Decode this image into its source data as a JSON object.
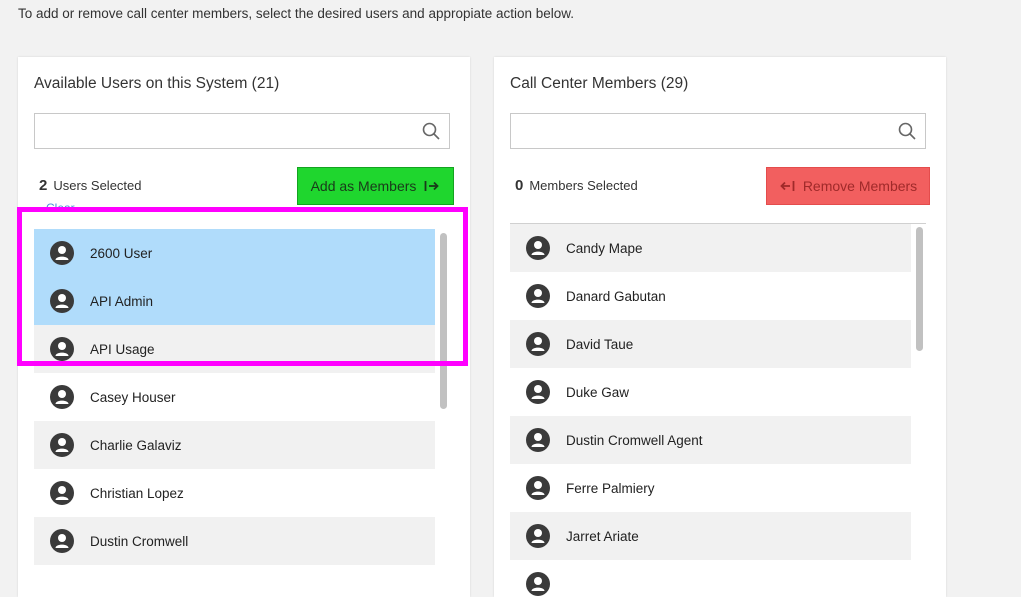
{
  "intro_text": "To add or remove call center members, select the desired users and appropiate action below.",
  "available": {
    "title": "Available Users on this System (21)",
    "search_placeholder": "",
    "selected_count": "2",
    "selected_label": "Users Selected",
    "clear_label": "Clear",
    "add_button_label": "Add as Members",
    "users": [
      {
        "name": "2600 User",
        "selected": true
      },
      {
        "name": "API Admin",
        "selected": true
      },
      {
        "name": "API Usage",
        "selected": false
      },
      {
        "name": "Casey Houser",
        "selected": false
      },
      {
        "name": "Charlie Galaviz",
        "selected": false
      },
      {
        "name": "Christian Lopez",
        "selected": false
      },
      {
        "name": "Dustin Cromwell",
        "selected": false
      }
    ]
  },
  "members": {
    "title": "Call Center Members (29)",
    "search_placeholder": "",
    "selected_count": "0",
    "selected_label": "Members Selected",
    "remove_button_label": "Remove Members",
    "users": [
      {
        "name": "Candy Mape"
      },
      {
        "name": "Danard Gabutan"
      },
      {
        "name": "David Taue"
      },
      {
        "name": "Duke Gaw"
      },
      {
        "name": "Dustin Cromwell Agent"
      },
      {
        "name": "Ferre Palmiery"
      },
      {
        "name": "Jarret Ariate"
      },
      {
        "name": ""
      }
    ]
  },
  "colors": {
    "selected_row": "#b0dcfb",
    "alt_row": "#f1f1f1",
    "add_button": "#1fd62e",
    "remove_button": "#f25f5f",
    "highlight_box": "#ff00ff"
  }
}
